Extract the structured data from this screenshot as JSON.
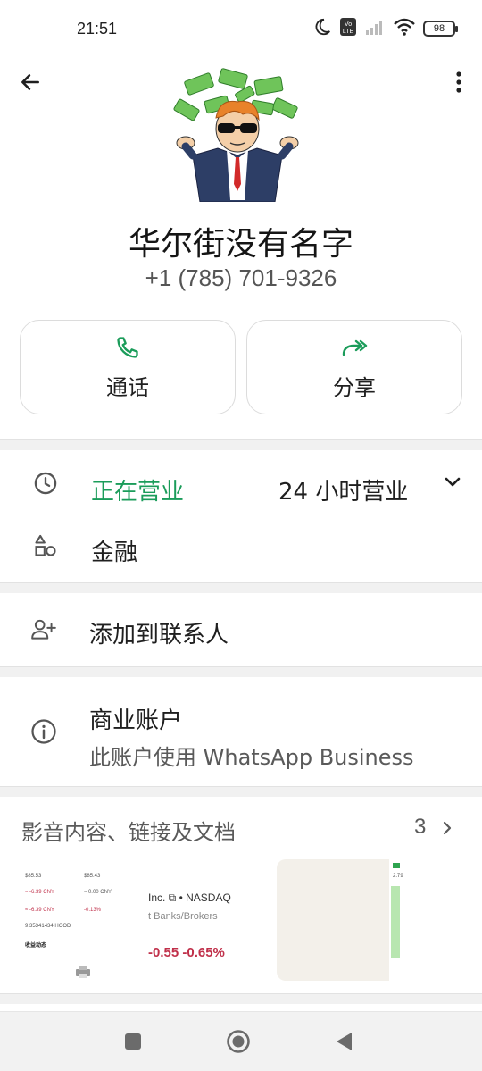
{
  "status_bar": {
    "time": "21:51",
    "battery": "98",
    "icons": [
      "moon-icon",
      "volte-icon",
      "signal-icon",
      "wifi-icon",
      "battery-icon"
    ]
  },
  "contact": {
    "name": "华尔街没有名字",
    "phone": "+1 (785) 701-9326"
  },
  "actions": [
    {
      "label": "通话",
      "icon": "phone-icon"
    },
    {
      "label": "分享",
      "icon": "share-icon"
    }
  ],
  "business_info": {
    "open_status": "正在营业",
    "hours": "24 小时营业",
    "category": "金融"
  },
  "add_contact_label": "添加到联系人",
  "business_account": {
    "title": "商业账户",
    "subtitle": "此账户使用 WhatsApp Business"
  },
  "media": {
    "title": "影音内容、链接及文档",
    "count": "3",
    "thumb1_lines": [
      "$85.53",
      "$85.43",
      "≈ -6.39 CNY",
      "≈ 0.00 CNY",
      "≈ -6.39 CNY",
      "-0.13%",
      "9.35341434 HOOD",
      "收益动态"
    ],
    "thumb2_lines": [
      "Inc. ⧉ • NASDAQ",
      "t Banks/Brokers",
      "-0.55  -0.65%"
    ],
    "thumb4_lines": [
      "2.79"
    ]
  },
  "colors": {
    "accent_green": "#1b9c5a",
    "text_primary": "#1f1f1f",
    "text_secondary": "#5a5a5a",
    "negative_red": "#c0304a"
  }
}
